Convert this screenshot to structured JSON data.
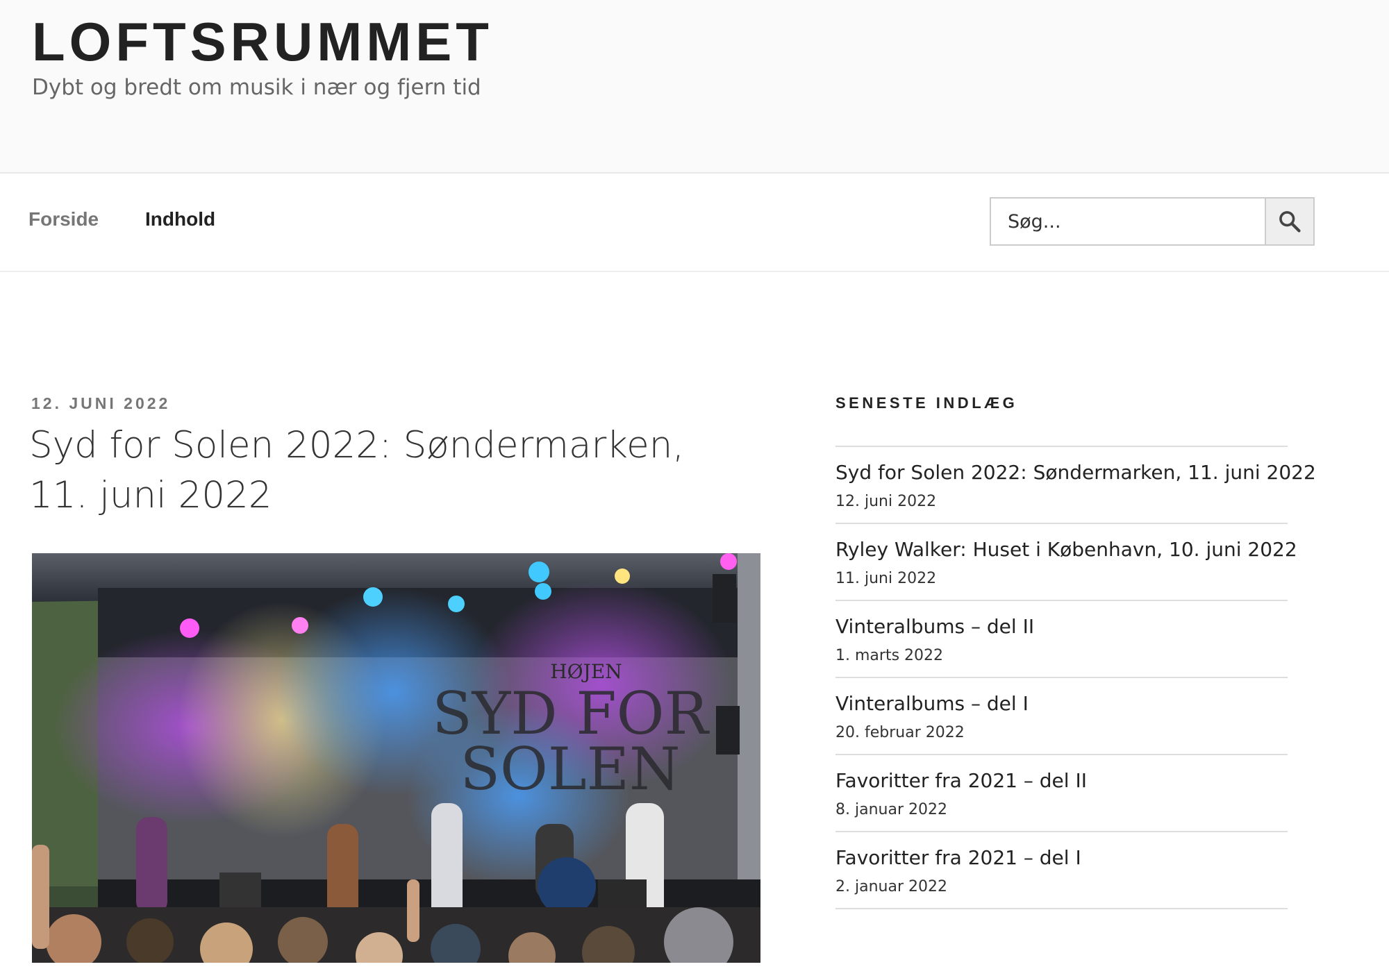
{
  "site": {
    "title": "LOFTSRUMMET",
    "description": "Dybt og bredt om musik i nær og fjern tid"
  },
  "nav": {
    "items": [
      {
        "label": "Forside"
      },
      {
        "label": "Indhold"
      }
    ]
  },
  "search": {
    "placeholder": "Søg...",
    "icon": "search-icon"
  },
  "post": {
    "date": "12. JUNI 2022",
    "title": "Syd for Solen 2022: Søndermarken, 11. juni 2022",
    "image_banner": {
      "line1": "HØJEN",
      "line2": "SYD FOR",
      "line3": "SOLEN"
    }
  },
  "sidebar": {
    "widget_title": "SENESTE INDLÆG",
    "posts": [
      {
        "title": "Syd for Solen 2022: Søndermarken, 11. juni 2022",
        "date": "12. juni 2022"
      },
      {
        "title": "Ryley Walker: Huset i København, 10. juni 2022",
        "date": "11. juni 2022"
      },
      {
        "title": "Vinteralbums – del II",
        "date": "1. marts 2022"
      },
      {
        "title": "Vinteralbums – del I",
        "date": "20. februar 2022"
      },
      {
        "title": "Favoritter fra 2021 – del II",
        "date": "8. januar 2022"
      },
      {
        "title": "Favoritter fra 2021 – del I",
        "date": "2. januar 2022"
      }
    ]
  },
  "colors": {
    "header_bg": "#fafafa",
    "text_dark": "#222222",
    "text_muted": "#767676"
  }
}
